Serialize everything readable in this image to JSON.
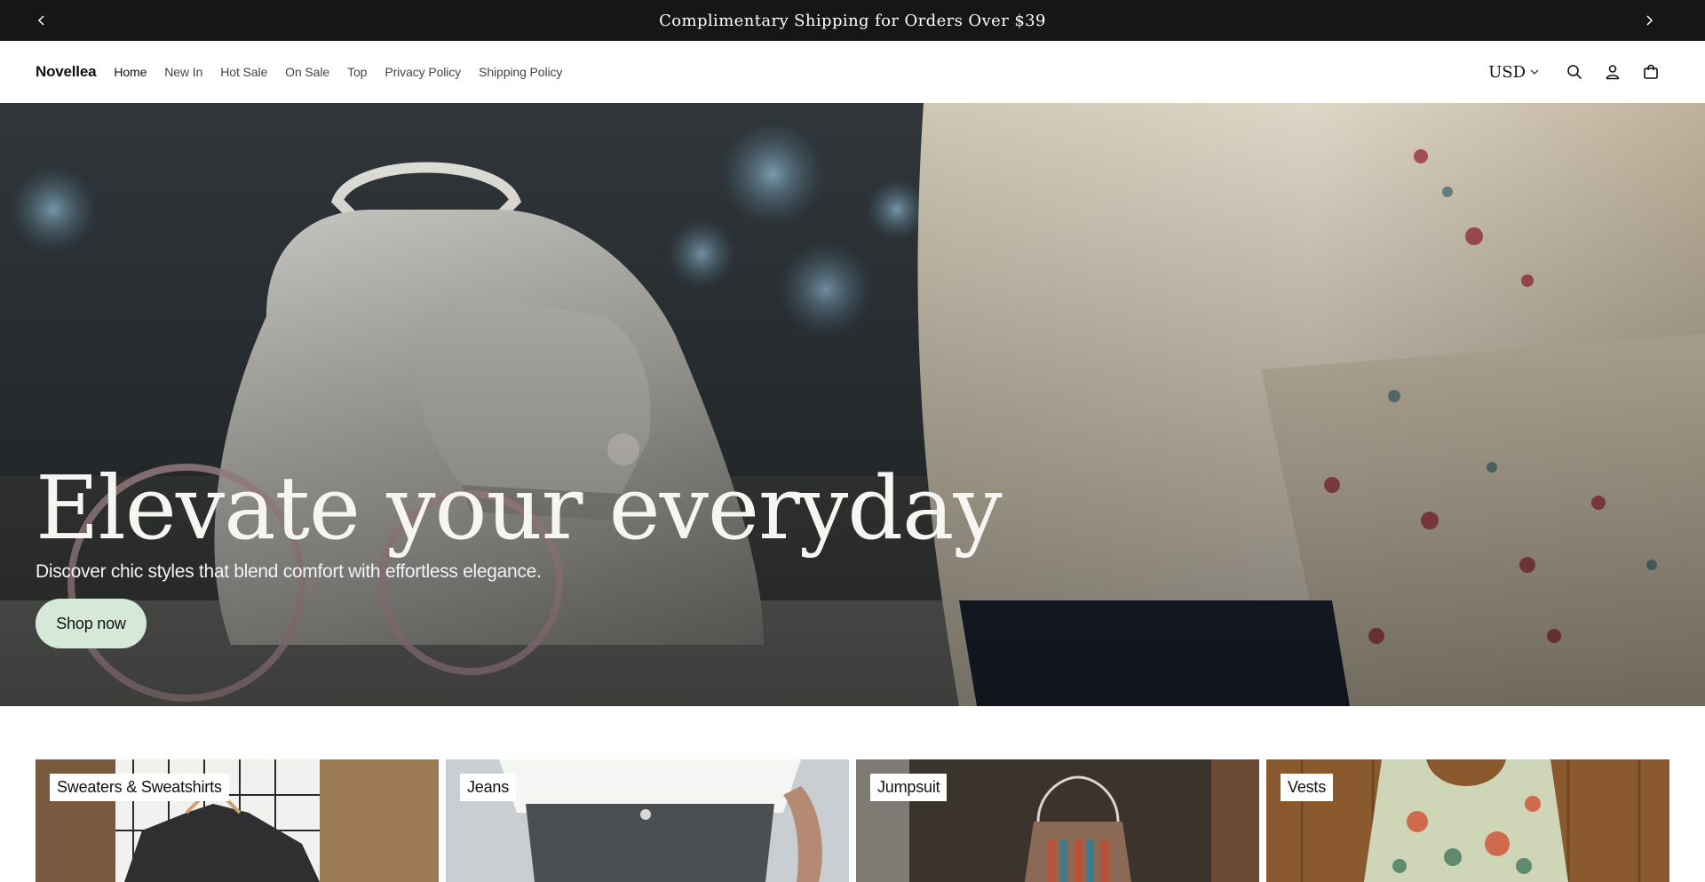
{
  "announcement": {
    "text": "Complimentary Shipping for Orders Over $39",
    "prev_icon": "chevron-left-icon",
    "next_icon": "chevron-right-icon"
  },
  "header": {
    "logo": "Novellea",
    "nav": [
      {
        "label": "Home",
        "active": true
      },
      {
        "label": "New In",
        "active": false
      },
      {
        "label": "Hot Sale",
        "active": false
      },
      {
        "label": "On Sale",
        "active": false
      },
      {
        "label": "Top",
        "active": false
      },
      {
        "label": "Privacy Policy",
        "active": false
      },
      {
        "label": "Shipping Policy",
        "active": false
      }
    ],
    "currency": "USD",
    "icons": [
      "search-icon",
      "account-icon",
      "cart-icon"
    ]
  },
  "hero": {
    "title": "Elevate your everyday",
    "subtitle": "Discover chic styles that blend comfort with effortless elegance.",
    "button_label": "Shop now",
    "button_color": "#d6e9d8"
  },
  "collections": [
    {
      "label": "Sweaters & Sweatshirts"
    },
    {
      "label": "Jeans"
    },
    {
      "label": "Jumpsuit"
    },
    {
      "label": "Vests"
    }
  ],
  "colors": {
    "announcement_bg": "#161616",
    "hero_text": "#f6f5f1"
  }
}
